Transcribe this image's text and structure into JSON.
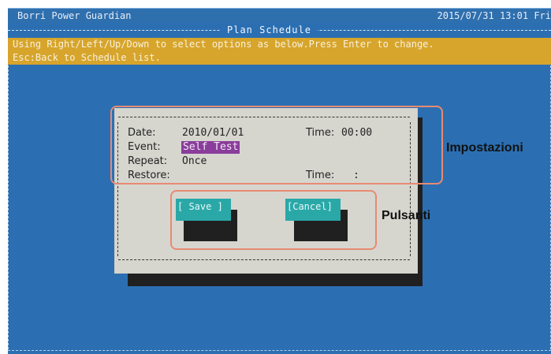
{
  "header": {
    "app_title": "Borri Power Guardian",
    "datetime": "2015/07/31 13:01 Fri",
    "section_title": "Plan  Schedule"
  },
  "instruction": {
    "line1": "Using Right/Left/Up/Down to select options as below.Press Enter to change.",
    "line2": "Esc:Back to Schedule list."
  },
  "form": {
    "date_label": "Date:",
    "date_value": "2010/01/01",
    "time_label": "Time:",
    "time_value": "00:00",
    "event_label": "Event:",
    "event_value": "Self Test",
    "repeat_label": "Repeat:",
    "repeat_value": "Once",
    "restore_label": "Restore:",
    "restore_time_label": "Time:",
    "restore_time_value": ":"
  },
  "buttons": {
    "save": "[ Save ]",
    "cancel": "[Cancel]"
  },
  "annotations": {
    "settings": "Impostazioni",
    "buttons": "Pulsanti"
  },
  "colors": {
    "screen_bg": "#2b6fb2",
    "instruction_bg": "#d7a52c",
    "dialog_bg": "#d6d6cf",
    "button_bg": "#2aa8a8",
    "event_highlight": "#8a3d9a",
    "annotation": "#e88a72"
  }
}
